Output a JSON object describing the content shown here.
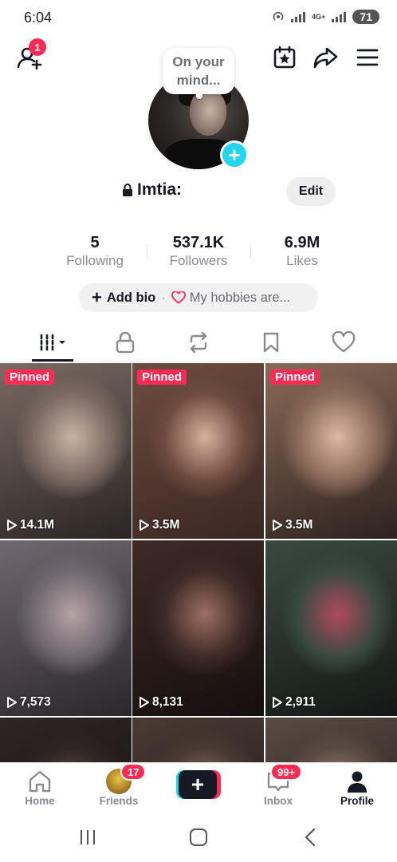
{
  "status_bar": {
    "time": "6:04",
    "network_label": "4G+",
    "battery": "71"
  },
  "top_nav": {
    "notification_count": "1",
    "icons": [
      "add-friend-icon",
      "calendar-star-icon",
      "share-icon",
      "menu-icon"
    ]
  },
  "profile": {
    "note_bubble": "On your mind...",
    "username": "Imtia:",
    "edit_label": "Edit",
    "stats": [
      {
        "value": "5",
        "label": "Following"
      },
      {
        "value": "537.1K",
        "label": "Followers"
      },
      {
        "value": "6.9M",
        "label": "Likes"
      }
    ],
    "bio": {
      "add_label": "Add bio",
      "separator": "·",
      "hobbies_label": "My hobbies are..."
    }
  },
  "tabs": [
    "videos-grid",
    "private",
    "reposts",
    "favorites",
    "liked"
  ],
  "videos": [
    {
      "pinned_label": "Pinned",
      "views": "14.1M",
      "colors": [
        "#7a6a62",
        "#2a2523",
        "#c9b2a4"
      ]
    },
    {
      "pinned_label": "Pinned",
      "views": "3.5M",
      "colors": [
        "#6e4c3f",
        "#3a2722",
        "#d8b09d"
      ]
    },
    {
      "pinned_label": "Pinned",
      "views": "3.5M",
      "colors": [
        "#8a6a58",
        "#2d221e",
        "#dcb8a4"
      ]
    },
    {
      "pinned_label": "",
      "views": "7,573",
      "colors": [
        "#6f6870",
        "#2c272b",
        "#b6a3a5"
      ]
    },
    {
      "pinned_label": "",
      "views": "8,131",
      "colors": [
        "#3e2a26",
        "#150f0e",
        "#9c6f63"
      ]
    },
    {
      "pinned_label": "",
      "views": "2,911",
      "colors": [
        "#3a4a40",
        "#141816",
        "#b04a5c"
      ]
    },
    {
      "pinned_label": "",
      "views": "",
      "colors": [
        "#2e2624",
        "#0f0c0b",
        "#6a4f48"
      ]
    },
    {
      "pinned_label": "",
      "views": "",
      "colors": [
        "#4a3a33",
        "#1a1412",
        "#9a7a6a"
      ]
    },
    {
      "pinned_label": "",
      "views": "",
      "colors": [
        "#5a4a42",
        "#1c1715",
        "#b08c7a"
      ]
    }
  ],
  "bottom_nav": {
    "home": "Home",
    "friends": "Friends",
    "friends_badge": "17",
    "create": "+",
    "inbox": "Inbox",
    "inbox_badge": "99+",
    "profile": "Profile"
  },
  "colors": {
    "brand_red": "#fe2c55",
    "brand_cyan": "#20d5ec",
    "text_primary": "#161823",
    "text_secondary": "#8a8b91"
  }
}
